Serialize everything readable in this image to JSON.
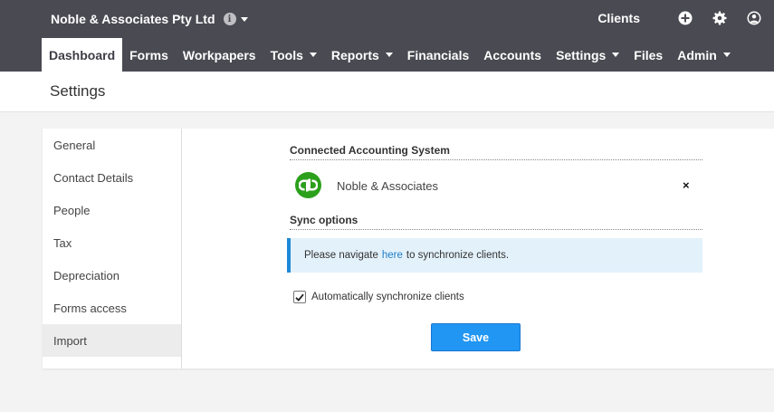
{
  "header": {
    "company_name": "Noble & Associates Pty Ltd",
    "clients_label": "Clients",
    "icons": [
      "info-icon",
      "add-circle-icon",
      "gear-icon",
      "user-account-icon"
    ]
  },
  "nav": {
    "items": [
      {
        "label": "Dashboard",
        "active": true,
        "dropdown": false
      },
      {
        "label": "Forms",
        "active": false,
        "dropdown": false
      },
      {
        "label": "Workpapers",
        "active": false,
        "dropdown": false
      },
      {
        "label": "Tools",
        "active": false,
        "dropdown": true
      },
      {
        "label": "Reports",
        "active": false,
        "dropdown": true
      },
      {
        "label": "Financials",
        "active": false,
        "dropdown": false
      },
      {
        "label": "Accounts",
        "active": false,
        "dropdown": false
      },
      {
        "label": "Settings",
        "active": false,
        "dropdown": true
      },
      {
        "label": "Files",
        "active": false,
        "dropdown": false
      },
      {
        "label": "Admin",
        "active": false,
        "dropdown": true
      }
    ]
  },
  "page": {
    "title": "Settings"
  },
  "sidebar": {
    "items": [
      {
        "label": "General",
        "active": false
      },
      {
        "label": "Contact Details",
        "active": false
      },
      {
        "label": "People",
        "active": false
      },
      {
        "label": "Tax",
        "active": false
      },
      {
        "label": "Depreciation",
        "active": false
      },
      {
        "label": "Forms access",
        "active": false
      },
      {
        "label": "Import",
        "active": true
      }
    ]
  },
  "main": {
    "connected_title": "Connected Accounting System",
    "account_name": "Noble & Associates",
    "remove_label": "×",
    "sync_title": "Sync options",
    "alert": {
      "before": "Please navigate",
      "link": "here",
      "after": "to synchronize clients."
    },
    "auto_sync_label": "Automatically synchronize clients",
    "auto_sync_checked": true,
    "save_label": "Save"
  },
  "colors": {
    "topbar": "#4a4a52",
    "accent": "#2196f3",
    "quickbooks_green": "#2ca01c",
    "alert_bg": "#e3f1fa"
  }
}
